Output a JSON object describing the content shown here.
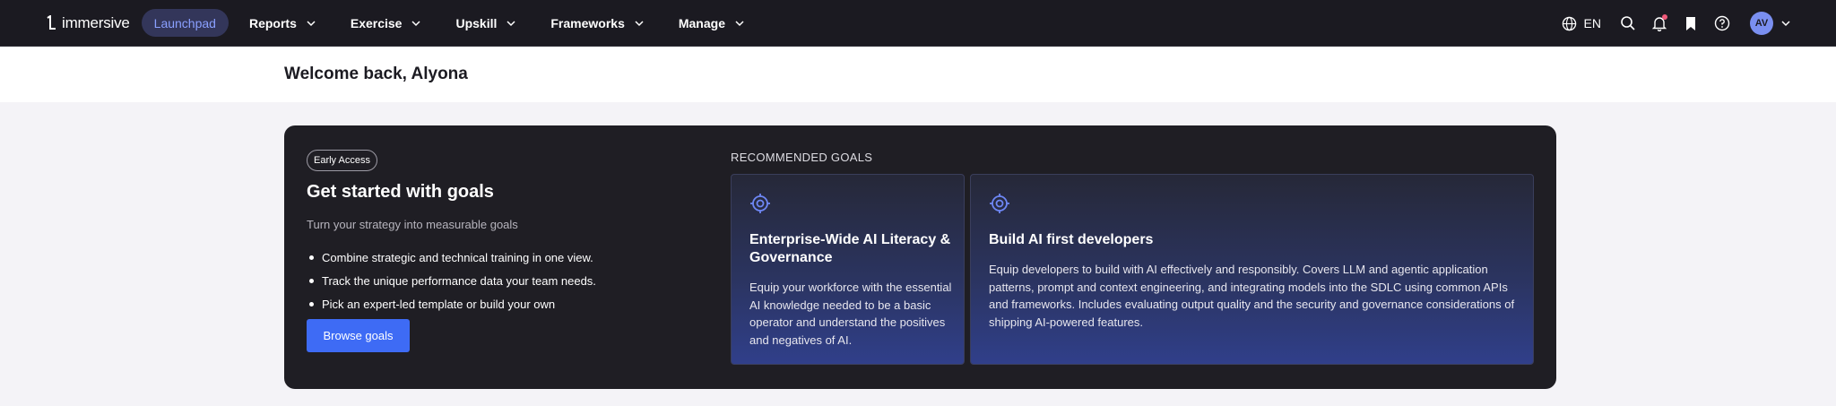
{
  "nav": {
    "logo_text": "immersive",
    "active_item": "Launchpad",
    "items": [
      {
        "label": "Reports"
      },
      {
        "label": "Exercise"
      },
      {
        "label": "Upskill"
      },
      {
        "label": "Frameworks"
      },
      {
        "label": "Manage"
      }
    ],
    "language": "EN",
    "avatar_initials": "AV",
    "icons": [
      "globe-icon",
      "search-icon",
      "bell-icon",
      "bookmark-icon",
      "help-icon",
      "chevron-down-icon"
    ]
  },
  "welcome": {
    "title": "Welcome back, Alyona"
  },
  "goals": {
    "badge": "Early Access",
    "title": "Get started with goals",
    "subtitle": "Turn your strategy into measurable goals",
    "bullets": [
      "Combine strategic and technical training in one view.",
      "Track the unique performance data your team needs.",
      "Pick an expert-led template or build your own"
    ],
    "browse_button": "Browse goals",
    "recommended_label": "RECOMMENDED GOALS",
    "recommended": [
      {
        "title": "Enterprise-Wide AI Literacy & Governance",
        "description": "Equip your workforce with the essential AI knowledge needed to be a basic operator and understand the positives and negatives of AI."
      },
      {
        "title": "Build AI first developers",
        "description": "Equip developers to build with AI effectively and responsibly. Covers LLM and agentic application patterns, prompt and context engineering, and integrating models into the SDLC using common APIs and frameworks. Includes evaluating output quality and the security and governance considerations of shipping AI-powered features."
      }
    ]
  },
  "colors": {
    "nav_bg": "#1b1a21",
    "accent": "#3e6bf5",
    "pill_bg": "#33365a",
    "pill_text": "#8aa0ff",
    "card_bg": "#1f1e24",
    "target_icon": "#6e87f5"
  }
}
